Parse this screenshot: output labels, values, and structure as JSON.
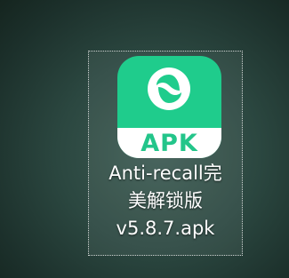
{
  "desktop": {
    "file": {
      "icon": "apk-file-icon",
      "badge_text": "APK",
      "name_lines": [
        "Anti-recall完",
        "美解锁版",
        "v5.8.7.apk"
      ],
      "colors": {
        "tile": "#1fcc8c",
        "band": "#ffffff",
        "badge_text": "#23c58a"
      }
    }
  }
}
